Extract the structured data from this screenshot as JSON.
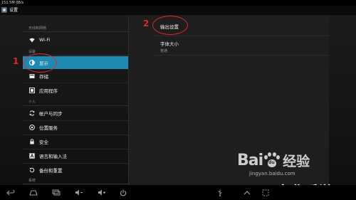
{
  "status_bar": {
    "text": "151.5M 0B/s"
  },
  "action_bar": {
    "title": "设置"
  },
  "sections": [
    {
      "header": "无线和网络"
    },
    {
      "header": "设备"
    },
    {
      "header": "个人"
    },
    {
      "header": "系统"
    }
  ],
  "nav_items": [
    {
      "label": "Wi-Fi",
      "icon": "wifi-icon",
      "selected": false
    },
    {
      "label": "显示",
      "icon": "display-icon",
      "selected": true
    },
    {
      "label": "存储",
      "icon": "storage-icon",
      "selected": false
    },
    {
      "label": "应用程序",
      "icon": "apps-icon",
      "selected": false
    },
    {
      "label": "帐户与同步",
      "icon": "sync-icon",
      "selected": false
    },
    {
      "label": "位置服务",
      "icon": "location-icon",
      "selected": false
    },
    {
      "label": "安全",
      "icon": "lock-icon",
      "selected": false
    },
    {
      "label": "语言和输入法",
      "icon": "language-icon",
      "selected": false
    },
    {
      "label": "备份和重置",
      "icon": "backup-icon",
      "selected": false
    }
  ],
  "detail": {
    "output_settings": {
      "title": "输出设置"
    },
    "font_size": {
      "title": "字体大小",
      "value": "普通"
    }
  },
  "annotations": {
    "one": "1",
    "two": "2"
  },
  "watermark": {
    "bai": "Bai",
    "du": "du",
    "cn": "经验",
    "url": "jingyan.baidu.com",
    "site": "京华手游网"
  },
  "navbar_icons": [
    "back-icon",
    "home-icon",
    "recent-apps-icon",
    "volume-down-icon",
    "volume-up-icon",
    "power-icon",
    "usb-icon",
    "expand-up-icon",
    "screenshot-icon"
  ],
  "colors": {
    "accent": "#1d8ab4",
    "annotation": "#e4262a"
  }
}
